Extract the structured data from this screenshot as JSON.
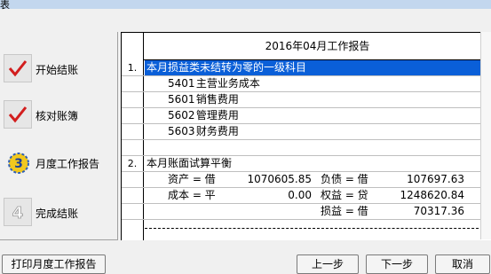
{
  "window": {
    "title_fragment": "表"
  },
  "steps": [
    {
      "label": "开始结账",
      "icon": "checkmark-icon"
    },
    {
      "label": "核对账簿",
      "icon": "checkmark-icon"
    },
    {
      "label": "月度工作报告",
      "icon": "step-3-icon"
    },
    {
      "label": "完成结账",
      "icon": "step-4-icon"
    }
  ],
  "report": {
    "title": "2016年04月工作报告",
    "section1": {
      "number": "1.",
      "heading": "本月损益类未结转为零的一级科目",
      "items": [
        {
          "code": "5401",
          "name": "主营业务成本"
        },
        {
          "code": "5601",
          "name": "销售费用"
        },
        {
          "code": "5602",
          "name": "管理费用"
        },
        {
          "code": "5603",
          "name": "财务费用"
        }
      ]
    },
    "section2": {
      "number": "2.",
      "heading": "本月账面试算平衡",
      "rows": [
        {
          "left_label": "资产 = 借",
          "left_value": "1070605.85",
          "right_label": "负债 = 借",
          "right_value": "107697.63"
        },
        {
          "left_label": "成本 = 平",
          "left_value": "0.00",
          "right_label": "权益 = 贷",
          "right_value": "1248620.84"
        },
        {
          "left_label": "",
          "left_value": "",
          "right_label": "损益 = 借",
          "right_value": "70317.36"
        }
      ]
    }
  },
  "buttons": {
    "print": "打印月度工作报告",
    "prev": "上一步",
    "next": "下一步",
    "cancel": "取消"
  }
}
